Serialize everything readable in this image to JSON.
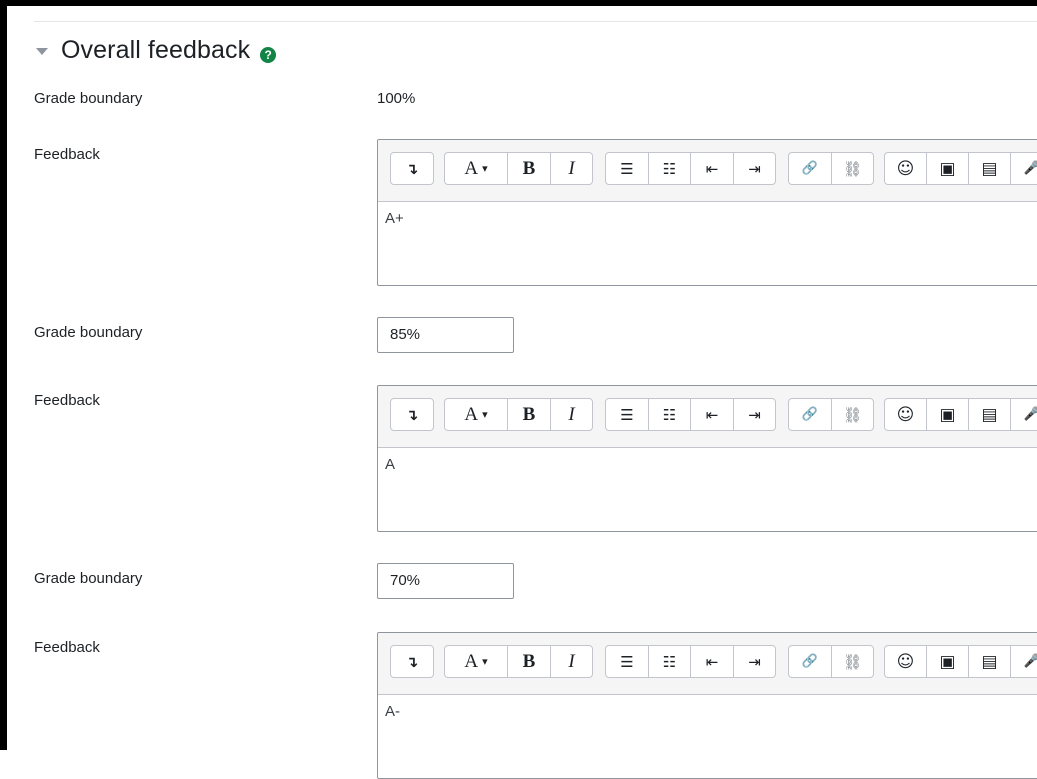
{
  "section": {
    "title": "Overall feedback",
    "help_icon": "question-circle-icon",
    "expanded_icon": "caret-down-icon"
  },
  "labels": {
    "grade_boundary": "Grade boundary",
    "feedback": "Feedback"
  },
  "toolbar": {
    "expand": "↴",
    "font_style": "A",
    "font_style_caret": "▾",
    "bold": "B",
    "italic": "I",
    "unordered_list": "☰",
    "ordered_list": "☷",
    "outdent": "⇤",
    "indent": "⇥",
    "link": "🔗",
    "unlink": "⛓",
    "emoji": "☺",
    "image": "▣",
    "media": "▤",
    "record_audio": "🎤"
  },
  "rows": [
    {
      "grade_boundary": "100%",
      "grade_editable": false,
      "feedback": "A+"
    },
    {
      "grade_boundary": "85%",
      "grade_editable": true,
      "feedback": "A"
    },
    {
      "grade_boundary": "70%",
      "grade_editable": true,
      "feedback": "A-"
    }
  ],
  "colors": {
    "help_icon": "#128445",
    "border": "#8f959e",
    "toolbar_bg": "#f5f5f5"
  }
}
